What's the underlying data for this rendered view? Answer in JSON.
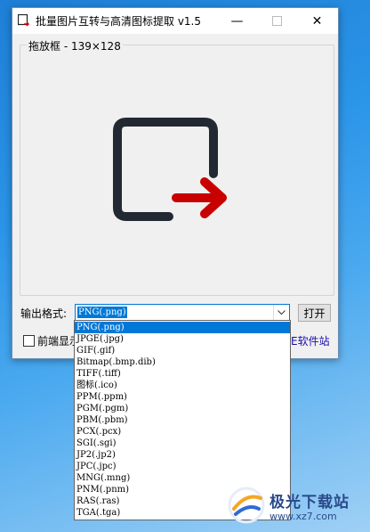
{
  "window": {
    "title": "批量图片互转与高清图标提取 v1.5",
    "minimize": "—",
    "close": "✕"
  },
  "drop_area": {
    "label": "拖放框 - 139×128"
  },
  "format": {
    "label": "输出格式:",
    "selected": "PNG(.png)",
    "options": [
      "PNG(.png)",
      "JPGE(.jpg)",
      "GIF(.gif)",
      "Bitmap(.bmp.dib)",
      "TIFF(.tiff)",
      "图标(.ico)",
      "PPM(.ppm)",
      "PGM(.pgm)",
      "PBM(.pbm)",
      "PCX(.pcx)",
      "SGI(.sgi)",
      "JP2(.jp2)",
      "JPC(.jpc)",
      "MNG(.mng)",
      "PNM(.pnm)",
      "RAS(.ras)",
      "TGA(.tga)"
    ]
  },
  "open_button": "打开",
  "topmost_checkbox": {
    "label": "前端显示",
    "checked": false
  },
  "site_link": "E软件站",
  "watermark": {
    "brand": "极光下载站",
    "url": "www.xz7.com"
  },
  "colors": {
    "accent": "#0078d7",
    "icon_dark": "#222933",
    "arrow_red": "#c80000"
  }
}
